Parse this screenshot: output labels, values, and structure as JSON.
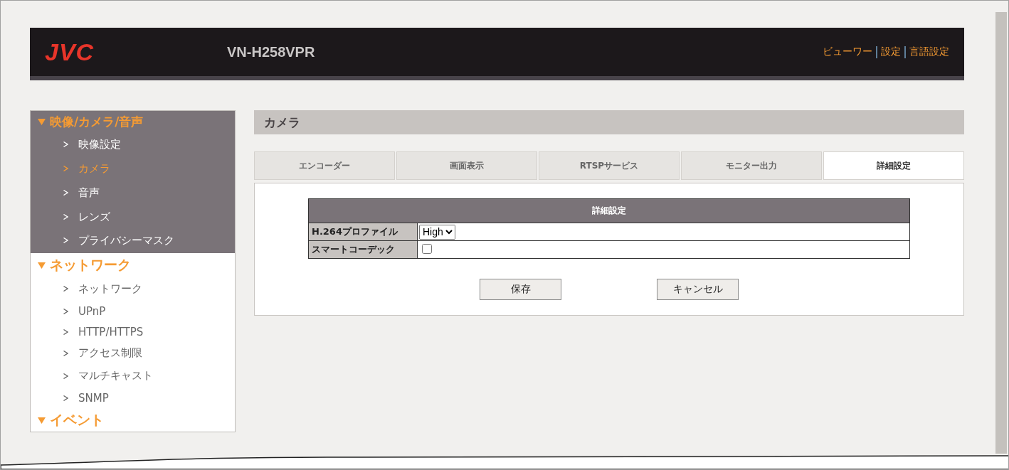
{
  "header": {
    "logo": "JVC",
    "model": "VN-H258VPR",
    "links": [
      {
        "label": "ビューワー"
      },
      {
        "label": "設定"
      },
      {
        "label": "言語設定"
      }
    ]
  },
  "sidebar": {
    "sections": [
      {
        "title": "映像/カメラ/音声",
        "expanded": true,
        "active": true,
        "items": [
          {
            "label": "映像設定",
            "selected": false
          },
          {
            "label": "カメラ",
            "selected": true
          },
          {
            "label": "音声",
            "selected": false
          },
          {
            "label": "レンズ",
            "selected": false
          },
          {
            "label": "プライバシーマスク",
            "selected": false
          }
        ]
      },
      {
        "title": "ネットワーク",
        "expanded": true,
        "active": false,
        "items": [
          {
            "label": "ネットワーク",
            "selected": false
          },
          {
            "label": "UPnP",
            "selected": false
          },
          {
            "label": "HTTP/HTTPS",
            "selected": false
          },
          {
            "label": "アクセス制限",
            "selected": false
          },
          {
            "label": "マルチキャスト",
            "selected": false
          },
          {
            "label": "SNMP",
            "selected": false
          }
        ]
      },
      {
        "title": "イベント",
        "expanded": true,
        "active": false
      }
    ]
  },
  "page": {
    "title": "カメラ",
    "tabs": [
      {
        "label": "エンコーダー",
        "selected": false
      },
      {
        "label": "画面表示",
        "selected": false
      },
      {
        "label": "RTSPサービス",
        "selected": false
      },
      {
        "label": "モニター出力",
        "selected": false
      },
      {
        "label": "詳細設定",
        "selected": true
      }
    ],
    "table": {
      "title": "詳細設定",
      "rows": [
        {
          "kind": "select",
          "label": "H.264プロファイル",
          "value": "High"
        },
        {
          "kind": "checkbox",
          "label": "スマートコーデック",
          "checked": false
        }
      ]
    },
    "buttons": [
      {
        "label": "保存"
      },
      {
        "label": "キャンセル"
      }
    ]
  }
}
